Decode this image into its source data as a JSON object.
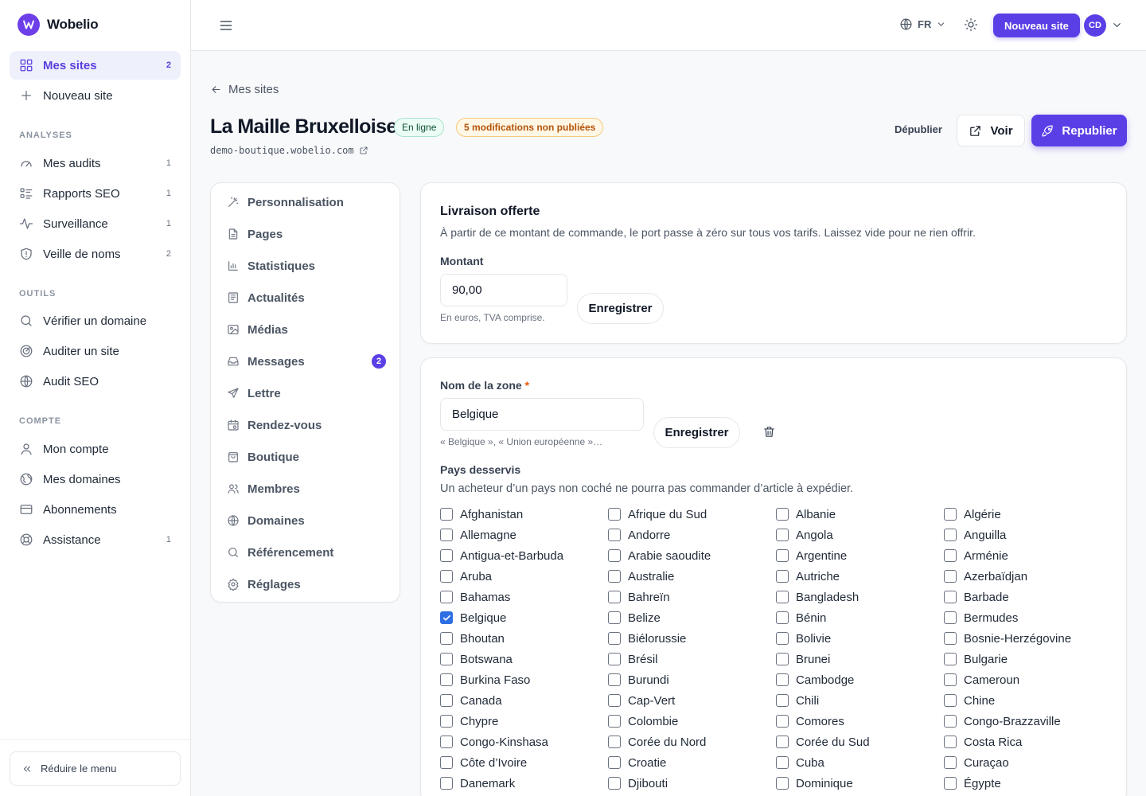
{
  "brand": {
    "name": "Wobelio"
  },
  "sidebar": {
    "main": [
      {
        "label": "Mes sites",
        "count": "2",
        "icon": "grid-icon",
        "active": true
      },
      {
        "label": "Nouveau site",
        "count": "",
        "icon": "plus-icon"
      }
    ],
    "sections": [
      {
        "title": "ANALYSES",
        "items": [
          {
            "label": "Mes audits",
            "count": "1",
            "icon": "gauge-icon"
          },
          {
            "label": "Rapports SEO",
            "count": "1",
            "icon": "list-icon"
          },
          {
            "label": "Surveillance",
            "count": "1",
            "icon": "pulse-icon"
          },
          {
            "label": "Veille de noms",
            "count": "2",
            "icon": "shield-icon"
          }
        ]
      },
      {
        "title": "OUTILS",
        "items": [
          {
            "label": "Vérifier un domaine",
            "count": "",
            "icon": "search-icon"
          },
          {
            "label": "Auditer un site",
            "count": "",
            "icon": "radar-icon"
          },
          {
            "label": "Audit SEO",
            "count": "",
            "icon": "globe-icon"
          }
        ]
      },
      {
        "title": "COMPTE",
        "items": [
          {
            "label": "Mon compte",
            "count": "",
            "icon": "user-icon"
          },
          {
            "label": "Mes domaines",
            "count": "",
            "icon": "world-icon"
          },
          {
            "label": "Abonnements",
            "count": "",
            "icon": "card-icon"
          },
          {
            "label": "Assistance",
            "count": "1",
            "icon": "lifebuoy-icon"
          }
        ]
      }
    ],
    "collapse_label": "Réduire le menu"
  },
  "topbar": {
    "lang": "FR",
    "new_site": "Nouveau site",
    "avatar": "CD"
  },
  "header": {
    "back": "Mes sites",
    "title": "La Maille Bruxelloise",
    "status": "En ligne",
    "changes": "5 modifications non publiées",
    "domain": "demo-boutique.wobelio.com",
    "unpublish": "Dépublier",
    "view": "Voir",
    "republish": "Republier"
  },
  "menu": [
    {
      "label": "Personnalisation",
      "icon": "wand-icon"
    },
    {
      "label": "Pages",
      "icon": "file-icon"
    },
    {
      "label": "Statistiques",
      "icon": "bar-chart-icon"
    },
    {
      "label": "Actualités",
      "icon": "newspaper-icon"
    },
    {
      "label": "Médias",
      "icon": "image-icon"
    },
    {
      "label": "Messages",
      "icon": "inbox-icon",
      "badge": "2"
    },
    {
      "label": "Lettre",
      "icon": "send-icon"
    },
    {
      "label": "Rendez-vous",
      "icon": "calendar-icon"
    },
    {
      "label": "Boutique",
      "icon": "bag-icon"
    },
    {
      "label": "Membres",
      "icon": "users-icon"
    },
    {
      "label": "Domaines",
      "icon": "globe-icon"
    },
    {
      "label": "Référencement",
      "icon": "search-icon"
    },
    {
      "label": "Réglages",
      "icon": "gear-icon"
    }
  ],
  "free_shipping": {
    "title": "Livraison offerte",
    "description": "À partir de ce montant de commande, le port passe à zéro sur tous vos tarifs. Laissez vide pour ne rien offrir.",
    "amount_label": "Montant",
    "amount_value": "90,00",
    "hint": "En euros, TVA comprise.",
    "save": "Enregistrer"
  },
  "zone": {
    "name_label": "Nom de la zone",
    "required_mark": "*",
    "name_value": "Belgique",
    "name_hint": "« Belgique », « Union européenne »…",
    "save": "Enregistrer",
    "countries_label": "Pays desservis",
    "countries_desc": "Un acheteur d’un pays non coché ne pourra pas commander d’article à expédier.",
    "countries": [
      {
        "name": "Afghanistan",
        "checked": false
      },
      {
        "name": "Afrique du Sud",
        "checked": false
      },
      {
        "name": "Albanie",
        "checked": false
      },
      {
        "name": "Algérie",
        "checked": false
      },
      {
        "name": "Allemagne",
        "checked": false
      },
      {
        "name": "Andorre",
        "checked": false
      },
      {
        "name": "Angola",
        "checked": false
      },
      {
        "name": "Anguilla",
        "checked": false
      },
      {
        "name": "Antigua-et-Barbuda",
        "checked": false
      },
      {
        "name": "Arabie saoudite",
        "checked": false
      },
      {
        "name": "Argentine",
        "checked": false
      },
      {
        "name": "Arménie",
        "checked": false
      },
      {
        "name": "Aruba",
        "checked": false
      },
      {
        "name": "Australie",
        "checked": false
      },
      {
        "name": "Autriche",
        "checked": false
      },
      {
        "name": "Azerbaïdjan",
        "checked": false
      },
      {
        "name": "Bahamas",
        "checked": false
      },
      {
        "name": "Bahreïn",
        "checked": false
      },
      {
        "name": "Bangladesh",
        "checked": false
      },
      {
        "name": "Barbade",
        "checked": false
      },
      {
        "name": "Belgique",
        "checked": true
      },
      {
        "name": "Belize",
        "checked": false
      },
      {
        "name": "Bénin",
        "checked": false
      },
      {
        "name": "Bermudes",
        "checked": false
      },
      {
        "name": "Bhoutan",
        "checked": false
      },
      {
        "name": "Biélorussie",
        "checked": false
      },
      {
        "name": "Bolivie",
        "checked": false
      },
      {
        "name": "Bosnie-Herzégovine",
        "checked": false
      },
      {
        "name": "Botswana",
        "checked": false
      },
      {
        "name": "Brésil",
        "checked": false
      },
      {
        "name": "Brunei",
        "checked": false
      },
      {
        "name": "Bulgarie",
        "checked": false
      },
      {
        "name": "Burkina Faso",
        "checked": false
      },
      {
        "name": "Burundi",
        "checked": false
      },
      {
        "name": "Cambodge",
        "checked": false
      },
      {
        "name": "Cameroun",
        "checked": false
      },
      {
        "name": "Canada",
        "checked": false
      },
      {
        "name": "Cap-Vert",
        "checked": false
      },
      {
        "name": "Chili",
        "checked": false
      },
      {
        "name": "Chine",
        "checked": false
      },
      {
        "name": "Chypre",
        "checked": false
      },
      {
        "name": "Colombie",
        "checked": false
      },
      {
        "name": "Comores",
        "checked": false
      },
      {
        "name": "Congo-Brazzaville",
        "checked": false
      },
      {
        "name": "Congo-Kinshasa",
        "checked": false
      },
      {
        "name": "Corée du Nord",
        "checked": false
      },
      {
        "name": "Corée du Sud",
        "checked": false
      },
      {
        "name": "Costa Rica",
        "checked": false
      },
      {
        "name": "Côte d’Ivoire",
        "checked": false
      },
      {
        "name": "Croatie",
        "checked": false
      },
      {
        "name": "Cuba",
        "checked": false
      },
      {
        "name": "Curaçao",
        "checked": false
      },
      {
        "name": "Danemark",
        "checked": false
      },
      {
        "name": "Djibouti",
        "checked": false
      },
      {
        "name": "Dominique",
        "checked": false
      },
      {
        "name": "Égypte",
        "checked": false
      }
    ]
  },
  "colors": {
    "accent": "#5b3fe6",
    "checkbox": "#2f6fe4",
    "warning": "#b45309",
    "success": "#0f5132"
  }
}
